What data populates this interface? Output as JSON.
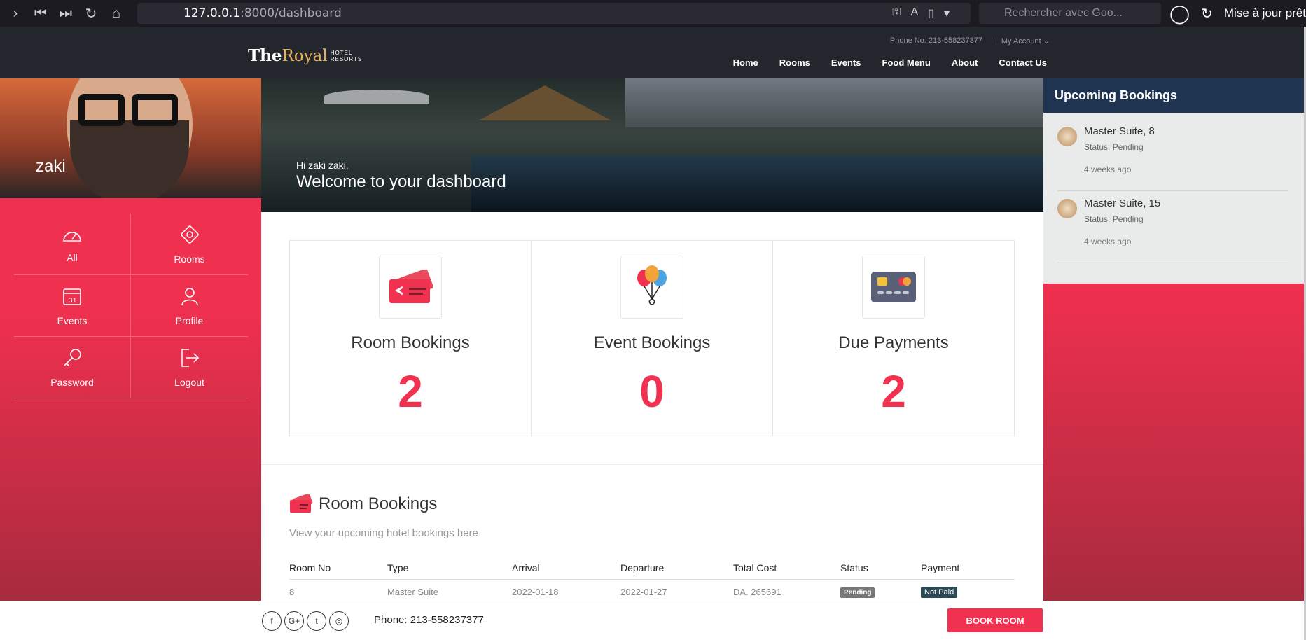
{
  "browser": {
    "url_host": "127.0.0.1",
    "url_rest": ":8000/dashboard",
    "search_placeholder": "Rechercher avec Goo...",
    "update_text": "Mise à jour prêt"
  },
  "header": {
    "logo_the": "The",
    "logo_royal": "Royal",
    "logo_sub1": "HOTEL",
    "logo_sub2": "RESORTS",
    "phone": "Phone No: 213-558237377",
    "account": "My Account ⌄",
    "nav": [
      "Home",
      "Rooms",
      "Events",
      "Food Menu",
      "About",
      "Contact Us"
    ]
  },
  "sidebar": {
    "username": "zaki",
    "items": [
      {
        "label": "All",
        "icon": "gauge-icon"
      },
      {
        "label": "Rooms",
        "icon": "ticket-icon"
      },
      {
        "label": "Events",
        "icon": "calendar-icon"
      },
      {
        "label": "Profile",
        "icon": "user-icon"
      },
      {
        "label": "Password",
        "icon": "key-icon"
      },
      {
        "label": "Logout",
        "icon": "logout-icon"
      }
    ]
  },
  "banner": {
    "greeting": "Hi zaki zaki,",
    "welcome": "Welcome to your dashboard"
  },
  "stats": [
    {
      "title": "Room Bookings",
      "value": "2",
      "icon": "ticket-icon"
    },
    {
      "title": "Event Bookings",
      "value": "0",
      "icon": "balloons-icon"
    },
    {
      "title": "Due Payments",
      "value": "2",
      "icon": "credit-card-icon"
    }
  ],
  "room_bookings": {
    "title": "Room Bookings",
    "subtitle": "View your upcoming hotel bookings here",
    "columns": [
      "Room No",
      "Type",
      "Arrival",
      "Departure",
      "Total Cost",
      "Status",
      "Payment"
    ],
    "rows": [
      {
        "room": "8",
        "type": "Master Suite",
        "arrival": "2022-01-18",
        "departure": "2022-01-27",
        "cost": "DA. 265691",
        "status": "Pending",
        "payment": "Not Paid"
      }
    ]
  },
  "upcoming": {
    "title": "Upcoming Bookings",
    "items": [
      {
        "title": "Master Suite, 8",
        "status": "Status: Pending",
        "time": "4 weeks ago"
      },
      {
        "title": "Master Suite, 15",
        "status": "Status: Pending",
        "time": "4 weeks ago"
      }
    ]
  },
  "footer": {
    "phone": "Phone: 213-558237377",
    "book_button": "BOOK ROOM",
    "socials": [
      "f",
      "G+",
      "t",
      "◎"
    ]
  },
  "colors": {
    "accent": "#f03150",
    "header": "#24262d",
    "upcoming_header": "#1f3450"
  }
}
